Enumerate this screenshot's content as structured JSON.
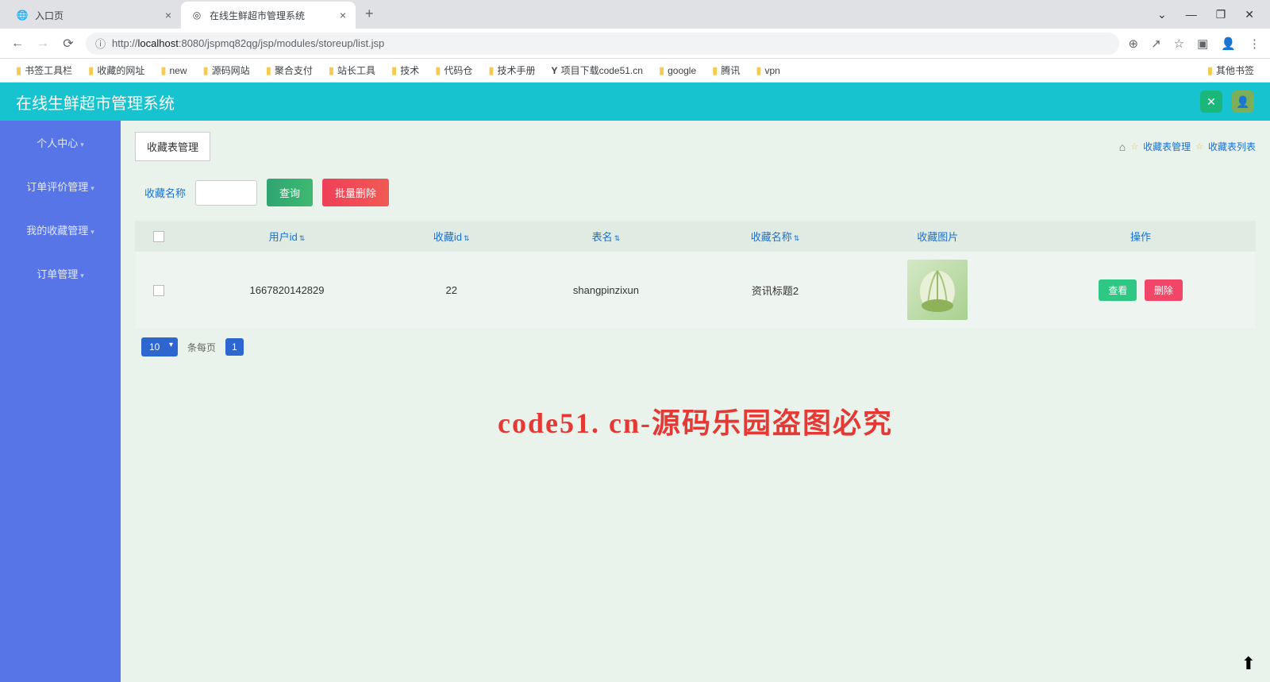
{
  "browser": {
    "tabs": [
      {
        "title": "入口页",
        "active": false
      },
      {
        "title": "在线生鲜超市管理系统",
        "active": true
      }
    ],
    "url_prefix": "http://",
    "url_host": "localhost",
    "url_path": ":8080/jspmq82qg/jsp/modules/storeup/list.jsp",
    "bookmarks": [
      "书签工具栏",
      "收藏的网址",
      "new",
      "源码网站",
      "聚合支付",
      "站长工具",
      "技术",
      "代码仓",
      "技术手册",
      "项目下载code51.cn",
      "google",
      "腾讯",
      "vpn"
    ],
    "bookmarks_right": "其他书签"
  },
  "header": {
    "title": "在线生鲜超市管理系统"
  },
  "sidebar": {
    "items": [
      {
        "label": "个人中心"
      },
      {
        "label": "订单评价管理"
      },
      {
        "label": "我的收藏管理"
      },
      {
        "label": "订单管理"
      }
    ]
  },
  "page": {
    "manage_btn": "收藏表管理",
    "breadcrumb": [
      "收藏表管理",
      "收藏表列表"
    ],
    "filter_label": "收藏名称",
    "search_btn": "查询",
    "bulk_delete_btn": "批量删除",
    "columns": [
      "用户id",
      "收藏id",
      "表名",
      "收藏名称",
      "收藏图片",
      "操作"
    ],
    "rows": [
      {
        "user_id": "1667820142829",
        "fav_id": "22",
        "table_name": "shangpinzixun",
        "fav_name": "资讯标题2",
        "view_btn": "查看",
        "del_btn": "删除"
      }
    ],
    "page_size": "10",
    "per_page_label": "条每页",
    "page_num": "1"
  },
  "watermark": "code51. cn-源码乐园盗图必究"
}
